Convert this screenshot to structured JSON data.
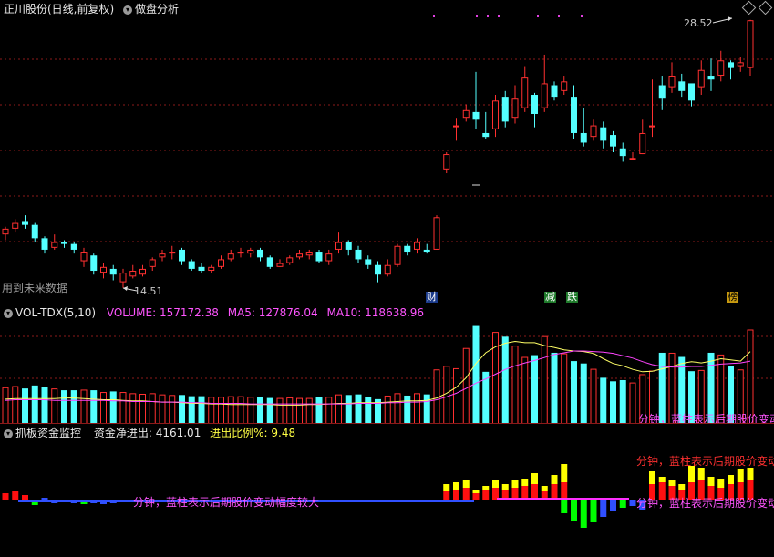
{
  "header": {
    "title": "正川股份(日线,前复权)",
    "analysis_label": "做盘分析"
  },
  "main": {
    "high_label": "28.52",
    "low_label": "14.51",
    "note": "用到未来数据",
    "events": [
      "财",
      "减",
      "跌",
      "榜"
    ]
  },
  "volume": {
    "name": "VOL-TDX(5,10)",
    "volume_label": "VOLUME: 157172.38",
    "ma5_label": "MA5: 127876.04",
    "ma10_label": "MA10: 118638.96",
    "overlay": "分钟，蓝柱表示后期股价变动"
  },
  "fund": {
    "name": "抓板资金监控",
    "net_label": "资金净进出: 4161.01",
    "ratio_label": "进出比例%: 9.48",
    "overlay_a": "分钟，蓝柱表示后期股价变动",
    "overlay_b": "分钟，蓝柱表示后期股价变动幅度较大"
  },
  "colors": {
    "up": "#ff3030",
    "down": "#54ffff",
    "grid": "#8c1a1a",
    "ma5": "#ffff66",
    "ma10": "#ff44ff",
    "fund_red": "#ff1010",
    "fund_yellow": "#ffff00",
    "fund_blue": "#3050ff",
    "fund_green": "#00ff00"
  },
  "chart_data": {
    "type": "candlestick",
    "price_min": 14.51,
    "price_max": 28.52,
    "candles": [
      [
        17.3,
        17.6,
        17.0,
        17.7
      ],
      [
        17.6,
        17.9,
        17.4,
        18.1
      ],
      [
        18.0,
        17.8,
        17.6,
        18.3
      ],
      [
        17.8,
        17.1,
        16.9,
        17.9
      ],
      [
        17.1,
        16.5,
        16.3,
        17.2
      ],
      [
        16.6,
        16.9,
        16.5,
        17.3
      ],
      [
        16.9,
        16.8,
        16.6,
        17.0
      ],
      [
        16.8,
        16.5,
        16.3,
        16.9
      ],
      [
        15.9,
        16.4,
        15.6,
        16.6
      ],
      [
        16.2,
        15.4,
        15.2,
        16.3
      ],
      [
        15.3,
        15.6,
        15.0,
        15.8
      ],
      [
        15.5,
        15.2,
        14.9,
        15.7
      ],
      [
        14.8,
        15.3,
        14.51,
        15.5
      ],
      [
        15.1,
        15.4,
        15.0,
        15.7
      ],
      [
        15.2,
        15.5,
        15.1,
        15.7
      ],
      [
        15.6,
        16.0,
        15.4,
        16.1
      ],
      [
        16.1,
        16.3,
        15.9,
        16.5
      ],
      [
        16.3,
        16.4,
        16.0,
        16.7
      ],
      [
        16.5,
        15.9,
        15.7,
        16.6
      ],
      [
        15.9,
        15.5,
        15.4,
        16.0
      ],
      [
        15.6,
        15.4,
        15.3,
        15.8
      ],
      [
        15.4,
        15.6,
        15.3,
        15.7
      ],
      [
        15.6,
        16.0,
        15.5,
        16.2
      ],
      [
        16.0,
        16.3,
        15.9,
        16.5
      ],
      [
        16.3,
        16.4,
        16.1,
        16.6
      ],
      [
        16.3,
        16.5,
        16.1,
        16.6
      ],
      [
        16.5,
        16.1,
        15.9,
        16.6
      ],
      [
        16.1,
        15.6,
        15.5,
        16.2
      ],
      [
        15.6,
        15.8,
        15.6,
        16.0
      ],
      [
        15.8,
        16.1,
        15.7,
        16.2
      ],
      [
        16.1,
        16.3,
        16.0,
        16.5
      ],
      [
        16.2,
        16.4,
        16.0,
        16.5
      ],
      [
        16.4,
        15.9,
        15.8,
        16.5
      ],
      [
        15.9,
        16.3,
        15.7,
        16.5
      ],
      [
        16.5,
        16.9,
        16.3,
        17.4
      ],
      [
        16.9,
        16.5,
        16.2,
        17.0
      ],
      [
        16.5,
        16.0,
        15.8,
        16.7
      ],
      [
        16.0,
        15.7,
        15.5,
        16.2
      ],
      [
        15.7,
        15.2,
        14.8,
        15.9
      ],
      [
        15.2,
        15.7,
        15.1,
        16.0
      ],
      [
        15.7,
        16.7,
        15.6,
        16.8
      ],
      [
        16.7,
        16.4,
        16.2,
        16.8
      ],
      [
        16.5,
        16.9,
        16.3,
        17.1
      ],
      [
        16.5,
        16.4,
        16.3,
        16.8
      ],
      [
        16.5,
        18.2,
        16.5,
        18.3
      ],
      [
        20.7,
        21.5,
        20.5,
        21.6
      ],
      [
        23.0,
        23.0,
        22.2,
        23.4
      ],
      [
        23.4,
        23.8,
        23.2,
        24.1
      ],
      [
        23.7,
        23.3,
        22.8,
        25.8
      ],
      [
        22.6,
        22.4,
        22.3,
        23.7
      ],
      [
        22.8,
        24.3,
        22.4,
        24.6
      ],
      [
        24.5,
        23.2,
        22.9,
        24.8
      ],
      [
        23.4,
        24.4,
        23.1,
        25.1
      ],
      [
        23.9,
        25.5,
        23.7,
        26.1
      ],
      [
        24.6,
        23.6,
        22.9,
        24.7
      ],
      [
        23.9,
        25.2,
        23.7,
        26.7
      ],
      [
        25.1,
        24.5,
        24.3,
        25.3
      ],
      [
        24.8,
        25.3,
        24.6,
        25.6
      ],
      [
        24.5,
        22.6,
        22.3,
        25.1
      ],
      [
        22.6,
        22.1,
        21.9,
        23.9
      ],
      [
        22.4,
        23.0,
        22.2,
        23.3
      ],
      [
        22.9,
        22.2,
        21.8,
        23.2
      ],
      [
        22.5,
        21.9,
        21.6,
        22.7
      ],
      [
        21.8,
        21.4,
        21.1,
        22.1
      ],
      [
        21.3,
        21.3,
        21.2,
        21.6
      ],
      [
        21.5,
        22.6,
        21.5,
        23.3
      ],
      [
        23.0,
        23.0,
        22.4,
        25.4
      ],
      [
        25.1,
        24.4,
        23.8,
        25.6
      ],
      [
        25.0,
        25.6,
        24.7,
        26.3
      ],
      [
        25.3,
        24.8,
        24.5,
        25.7
      ],
      [
        25.2,
        24.3,
        24.0,
        24.9
      ],
      [
        25.0,
        25.9,
        24.6,
        26.4
      ],
      [
        25.6,
        25.4,
        24.8,
        26.5
      ],
      [
        25.6,
        26.4,
        25.3,
        26.9
      ],
      [
        26.3,
        26.0,
        25.4,
        26.4
      ],
      [
        26.1,
        26.3,
        25.8,
        26.6
      ],
      [
        26.0,
        28.5,
        25.6,
        28.52
      ]
    ],
    "volume": {
      "values": [
        60,
        62,
        58,
        63,
        60,
        58,
        55,
        55,
        56,
        55,
        52,
        53,
        52,
        50,
        49,
        50,
        48,
        47,
        47,
        45,
        45,
        44,
        44,
        45,
        45,
        44,
        44,
        42,
        42,
        43,
        42,
        42,
        43,
        44,
        48,
        47,
        48,
        44,
        40,
        46,
        50,
        46,
        50,
        48,
        90,
        96,
        92,
        126,
        163,
        86,
        153,
        145,
        130,
        111,
        114,
        146,
        118,
        117,
        104,
        100,
        91,
        76,
        70,
        72,
        68,
        82,
        88,
        118,
        118,
        111,
        87,
        89,
        118,
        115,
        95,
        90,
        157
      ],
      "ma5": [
        40,
        41,
        41,
        41,
        41,
        41,
        42,
        42,
        41,
        40,
        39,
        39,
        38,
        37,
        37,
        36,
        35,
        35,
        34,
        33,
        33,
        32,
        32,
        31,
        31,
        31,
        31,
        31,
        30,
        30,
        30,
        31,
        31,
        32,
        33,
        33,
        34,
        34,
        34,
        35,
        36,
        37,
        37,
        38,
        42,
        50,
        60,
        76,
        100,
        118,
        128,
        134,
        137,
        135,
        135,
        130,
        127,
        123,
        121,
        120,
        117,
        108,
        100,
        96,
        90,
        86,
        87,
        91,
        95,
        100,
        103,
        101,
        104,
        108,
        106,
        104,
        120
      ],
      "ma10": [
        38,
        39,
        39,
        39,
        39,
        38,
        38,
        38,
        38,
        38,
        38,
        37,
        37,
        36,
        36,
        36,
        35,
        35,
        35,
        34,
        34,
        33,
        33,
        33,
        33,
        32,
        32,
        32,
        32,
        32,
        32,
        32,
        32,
        32,
        32,
        32,
        33,
        33,
        33,
        34,
        34,
        35,
        35,
        36,
        39,
        44,
        50,
        58,
        67,
        74,
        82,
        90,
        96,
        101,
        105,
        110,
        115,
        118,
        121,
        121,
        120,
        119,
        117,
        113,
        109,
        103,
        98,
        95,
        94,
        94,
        95,
        95,
        97,
        99,
        100,
        101,
        104
      ]
    }
  }
}
